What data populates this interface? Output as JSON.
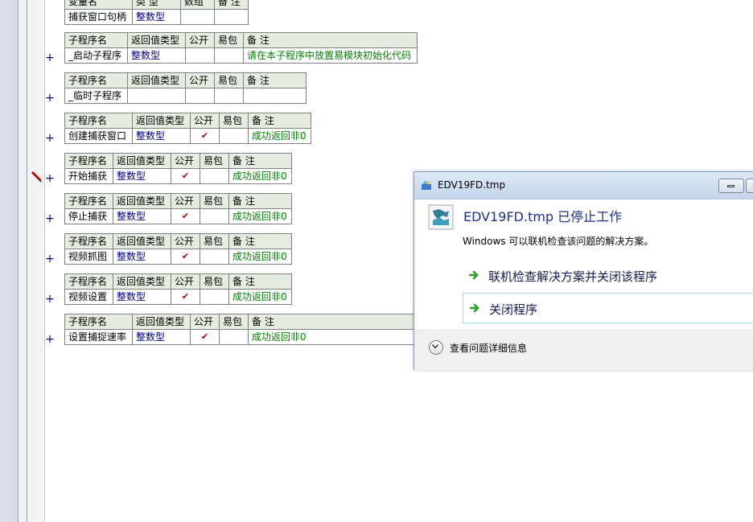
{
  "dialog": {
    "title": "EDV19FD.tmp",
    "headline": "EDV19FD.tmp 已停止工作",
    "message": "Windows 可以联机检查该问题的解决方案。",
    "option_check_online": "联机检查解决方案并关闭该程序",
    "option_close": "关闭程序",
    "details_label": "查看问题详细信息"
  },
  "var_table": {
    "headers": [
      "变量名",
      "类 型",
      "数组",
      "备 注"
    ],
    "row": [
      "捕获窗口句柄",
      "整数型",
      "",
      ""
    ]
  },
  "sub_headers": [
    "子程序名",
    "返回值类型",
    "公开",
    "易包",
    "备 注"
  ],
  "plus_sign": "+",
  "check_mark": "✔",
  "subroutines": [
    {
      "name": "_启动子程序",
      "type": "整数型",
      "public": "",
      "note": "请在本子程序中放置易模块初始化代码"
    },
    {
      "name": "_临时子程序",
      "type": "",
      "public": "",
      "note": ""
    },
    {
      "name": "创建捕获窗口",
      "type": "整数型",
      "public": "✔",
      "note": "成功返回非0"
    },
    {
      "name": "开始捕获",
      "type": "整数型",
      "public": "✔",
      "note": "成功返回非0"
    },
    {
      "name": "停止捕获",
      "type": "整数型",
      "public": "✔",
      "note": "成功返回非0"
    },
    {
      "name": "视频抓图",
      "type": "整数型",
      "public": "✔",
      "note": "成功返回非0"
    },
    {
      "name": "视频设置",
      "type": "整数型",
      "public": "✔",
      "note": "成功返回非0"
    },
    {
      "name": "设置捕捉速率",
      "type": "整数型",
      "public": "✔",
      "note": "成功返回非0"
    }
  ]
}
